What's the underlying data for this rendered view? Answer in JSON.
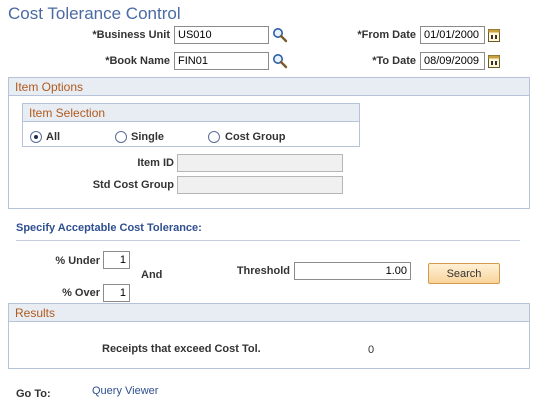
{
  "page": {
    "title": "Cost Tolerance Control"
  },
  "criteria": {
    "business_unit_label": "*Business Unit",
    "business_unit_value": "US010",
    "book_name_label": "*Book Name",
    "book_name_value": "FIN01",
    "from_date_label": "*From Date",
    "from_date_value": "01/01/2000",
    "to_date_label": "*To Date",
    "to_date_value": "08/09/2009"
  },
  "item_options": {
    "header": "Item Options",
    "selection_header": "Item Selection",
    "radios": [
      {
        "label": "All",
        "checked": true
      },
      {
        "label": "Single",
        "checked": false
      },
      {
        "label": "Cost Group",
        "checked": false
      }
    ],
    "item_id_label": "Item ID",
    "item_id_value": "",
    "std_cost_group_label": "Std Cost Group",
    "std_cost_group_value": ""
  },
  "tolerance": {
    "section_title": "Specify Acceptable Cost Tolerance:",
    "under_label": "% Under",
    "under_value": "1",
    "and_label": "And",
    "over_label": "% Over",
    "over_value": "1",
    "threshold_label": "Threshold",
    "threshold_value": "1.00",
    "search_label": "Search"
  },
  "results": {
    "header": "Results",
    "receipts_label": "Receipts that exceed Cost Tol.",
    "receipts_value": "0"
  },
  "goto": {
    "label": "Go To:",
    "link": "Query Viewer"
  },
  "icons": {
    "lookup": "magnifier-icon",
    "calendar": "calendar-icon"
  },
  "colors": {
    "title": "#4a6aa4",
    "group_header_text": "#b05a1e",
    "group_border": "#b7c3d8",
    "link": "#2f4f8f",
    "button": "#f8d49b"
  }
}
